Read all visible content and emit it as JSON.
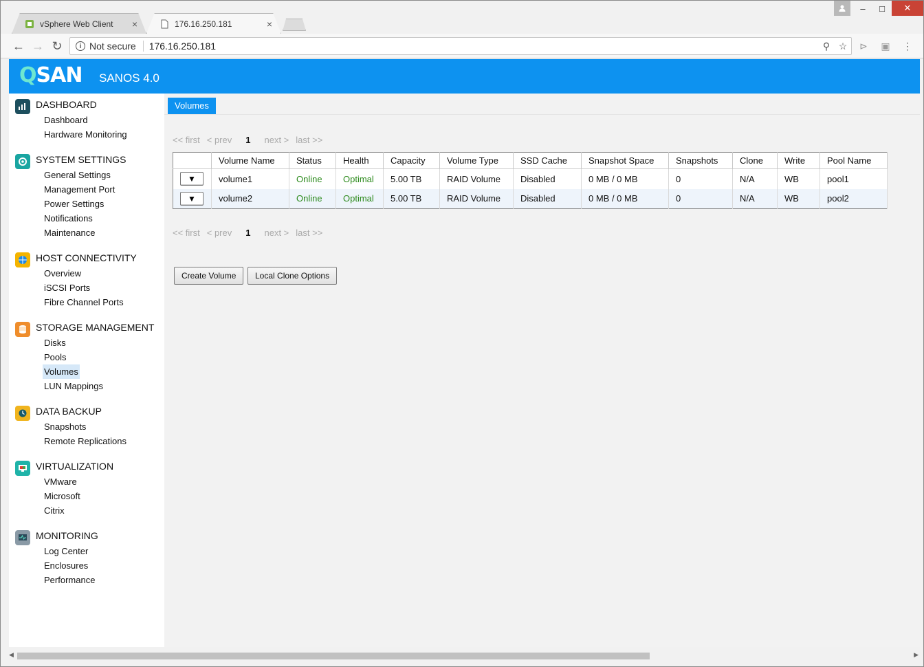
{
  "browser": {
    "tabs": [
      {
        "title": "vSphere Web Client",
        "close": "×"
      },
      {
        "title": "176.16.250.181",
        "close": "×"
      }
    ],
    "security_label": "Not secure",
    "url": "176.16.250.181",
    "window_controls": {
      "minimize": "‒",
      "maximize": "□",
      "close": "✕"
    }
  },
  "app": {
    "logo_q": "Q",
    "logo_rest": "SAN",
    "product": "SANOS 4.0"
  },
  "sidebar": {
    "sections": [
      {
        "title": "DASHBOARD",
        "icon": "dashboard-icon",
        "color": "#1d4f5e",
        "items": [
          "Dashboard",
          "Hardware Monitoring"
        ]
      },
      {
        "title": "SYSTEM SETTINGS",
        "icon": "settings-icon",
        "color": "#19a5a1",
        "items": [
          "General Settings",
          "Management Port",
          "Power Settings",
          "Notifications",
          "Maintenance"
        ]
      },
      {
        "title": "HOST CONNECTIVITY",
        "icon": "host-connectivity-icon",
        "color": "#f4b400",
        "items": [
          "Overview",
          "iSCSI Ports",
          "Fibre Channel Ports"
        ]
      },
      {
        "title": "STORAGE MANAGEMENT",
        "icon": "storage-icon",
        "color": "#ef8d2b",
        "items": [
          "Disks",
          "Pools",
          "Volumes",
          "LUN Mappings"
        ]
      },
      {
        "title": "DATA BACKUP",
        "icon": "backup-icon",
        "color": "#f0b41e",
        "items": [
          "Snapshots",
          "Remote Replications"
        ]
      },
      {
        "title": "VIRTUALIZATION",
        "icon": "virtualization-icon",
        "color": "#1fb3a8",
        "items": [
          "VMware",
          "Microsoft",
          "Citrix"
        ]
      },
      {
        "title": "MONITORING",
        "icon": "monitoring-icon",
        "color": "#8a9aa6",
        "items": [
          "Log Center",
          "Enclosures",
          "Performance"
        ]
      }
    ],
    "selected": "Volumes"
  },
  "main": {
    "page_tab": "Volumes",
    "pager": {
      "first": "<< first",
      "prev": "< prev",
      "current": "1",
      "next": "next >",
      "last": "last >>"
    },
    "table": {
      "columns": [
        "",
        "Volume Name",
        "Status",
        "Health",
        "Capacity",
        "Volume Type",
        "SSD Cache",
        "Snapshot Space",
        "Snapshots",
        "Clone",
        "Write",
        "Pool Name"
      ],
      "rows": [
        {
          "action": "▼",
          "name": "volume1",
          "status": "Online",
          "health": "Optimal",
          "capacity": "5.00 TB",
          "type": "RAID Volume",
          "ssd_cache": "Disabled",
          "snapshot_space": "0 MB / 0 MB",
          "snapshots": "0",
          "clone": "N/A",
          "write": "WB",
          "pool": "pool1"
        },
        {
          "action": "▼",
          "name": "volume2",
          "status": "Online",
          "health": "Optimal",
          "capacity": "5.00 TB",
          "type": "RAID Volume",
          "ssd_cache": "Disabled",
          "snapshot_space": "0 MB / 0 MB",
          "snapshots": "0",
          "clone": "N/A",
          "write": "WB",
          "pool": "pool2"
        }
      ]
    },
    "buttons": {
      "create": "Create Volume",
      "clone_options": "Local Clone Options"
    }
  }
}
